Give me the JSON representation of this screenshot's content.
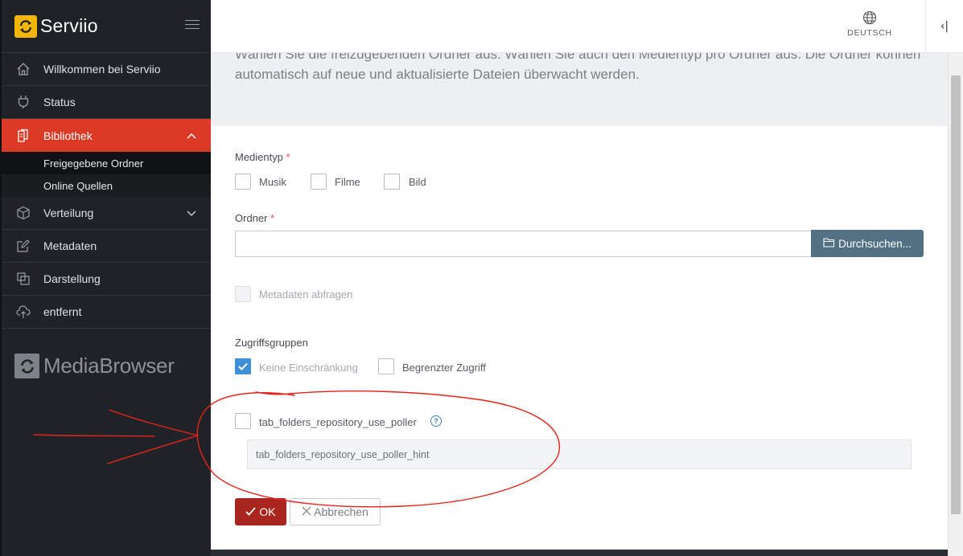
{
  "brand": {
    "name": "Serviio"
  },
  "sidebar": {
    "items": [
      {
        "label": "Willkommen bei Serviio",
        "icon": "home-icon"
      },
      {
        "label": "Status",
        "icon": "plug-icon"
      },
      {
        "label": "Bibliothek",
        "icon": "library-icon"
      },
      {
        "label": "Verteilung",
        "icon": "box-icon"
      },
      {
        "label": "Metadaten",
        "icon": "edit-icon"
      },
      {
        "label": "Darstellung",
        "icon": "copy-icon"
      },
      {
        "label": "entfernt",
        "icon": "cloud-icon"
      }
    ],
    "library_sub": [
      {
        "label": "Freigegebene Ordner"
      },
      {
        "label": "Online Quellen"
      }
    ],
    "media_browser": "MediaBrowser"
  },
  "header": {
    "language": "DEUTSCH",
    "collapse_glyph": "‹|"
  },
  "main": {
    "intro": "Wählen Sie die freizugebenden Ordner aus. Wählen Sie auch den Medientyp pro Ordner aus. Die Ordner können automatisch auf neue und aktualisierte Dateien überwacht werden.",
    "media_type_label": "Medientyp",
    "required_mark": "*",
    "media_types": [
      "Musik",
      "Filme",
      "Bild"
    ],
    "folder_label": "Ordner",
    "folder_value": "",
    "browse_label": "Durchsuchen...",
    "metadata_label": "Metadaten abfragen",
    "access_groups_label": "Zugriffsgruppen",
    "access_groups": [
      {
        "label": "Keine Einschränkung",
        "checked": true
      },
      {
        "label": "Begrenzter Zugriff",
        "checked": false
      }
    ],
    "poller_label": "tab_folders_repository_use_poller",
    "help_glyph": "?",
    "poller_hint": "tab_folders_repository_use_poller_hint",
    "ok_label": "OK",
    "cancel_label": "Abbrechen"
  },
  "colors": {
    "sidebar_bg": "#1f2226",
    "active": "#db3b26",
    "brand_yellow": "#f2b705",
    "browse_btn": "#527183",
    "ok_btn": "#a9261f",
    "checkbox_checked": "#3d8fd6",
    "annotation": "#e8221a"
  }
}
